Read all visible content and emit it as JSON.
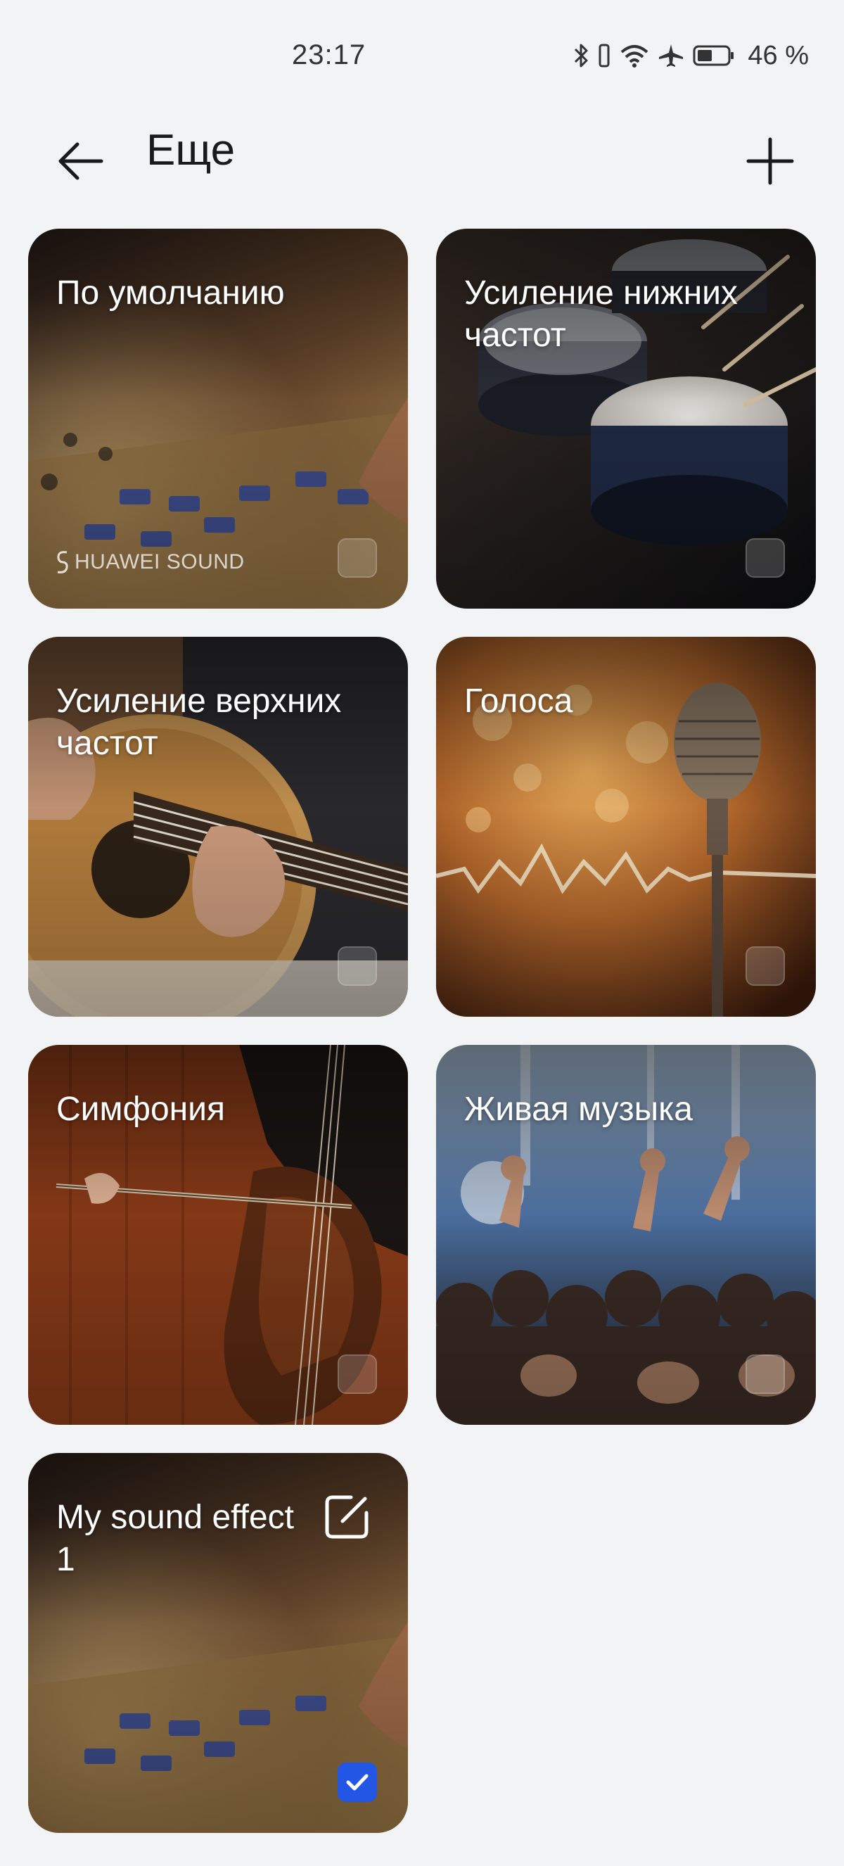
{
  "status_bar": {
    "time": "23:17",
    "battery": "46 %",
    "icons": [
      "bluetooth-icon",
      "vibrate-icon",
      "wifi-icon",
      "airplane-icon",
      "battery-icon"
    ]
  },
  "header": {
    "title": "Еще",
    "back_icon": "arrow-left-icon",
    "add_icon": "plus-icon"
  },
  "cards": [
    {
      "title": "По умолчанию",
      "brand": "HUAWEI SOUND",
      "checked": false,
      "theme": "mixer"
    },
    {
      "title": "Усиление нижних частот",
      "checked": false,
      "theme": "drums"
    },
    {
      "title": "Усиление верхних частот",
      "checked": false,
      "theme": "guitar"
    },
    {
      "title": "Голоса",
      "checked": false,
      "theme": "microphone"
    },
    {
      "title": "Симфония",
      "checked": false,
      "theme": "cello"
    },
    {
      "title": "Живая музыка",
      "checked": false,
      "theme": "concert"
    },
    {
      "title": "My sound effect 1",
      "checked": true,
      "editable": true,
      "theme": "mixer"
    }
  ],
  "colors": {
    "background": "#f1f3f5",
    "accent": "#2456e6"
  }
}
